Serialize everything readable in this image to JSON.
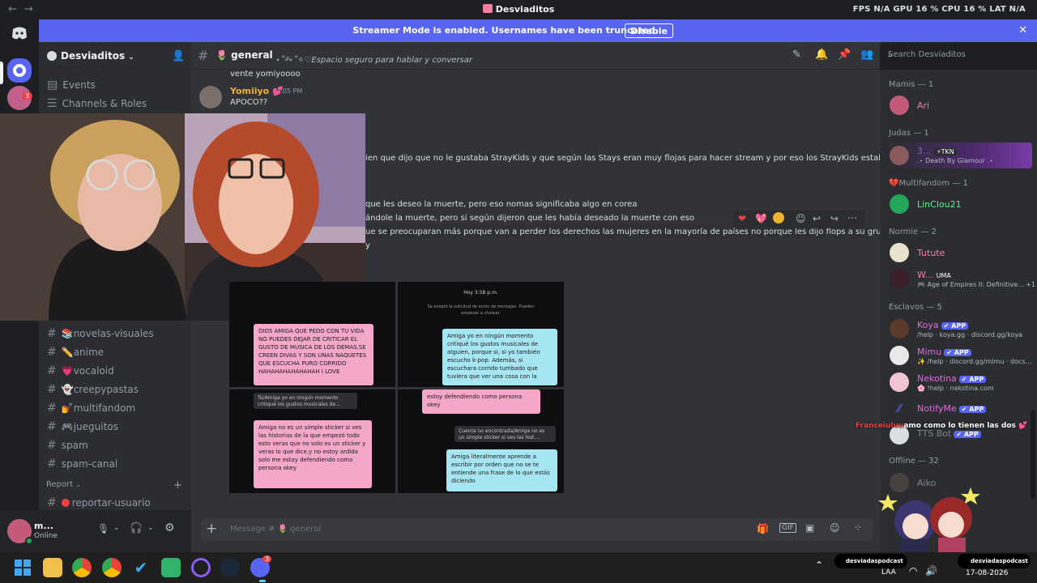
{
  "titlebar": {
    "back": "←",
    "forward": "→",
    "title": "Desviaditos",
    "stats": "FPS  N/A   GPU 16 %   CPU 16 %   LAT  N/A"
  },
  "banner": {
    "text": "Streamer Mode is enabled. Usernames have been truncated.",
    "button": "Disable",
    "close": "✕"
  },
  "server": {
    "name": "Desviaditos"
  },
  "sidebar": {
    "events": "Events",
    "channels_roles": "Channels & Roles",
    "channels": [
      "novelas-visuales",
      "anime",
      "vocaloid",
      "creepypastas",
      "multifandom",
      "jueguitos",
      "spam",
      "spam-canal"
    ],
    "channel_emojis": [
      "📚",
      "✏️",
      "💗",
      "👻",
      "💅",
      "🎮",
      "",
      ""
    ],
    "category_report": "Report",
    "report_channel": "reportar-usuario"
  },
  "chat": {
    "channel": "general",
    "topic": "⋆˚࿔⋆˚✧♡Espacio seguro para hablar y conversar",
    "search_placeholder": "Search Desviaditos",
    "input_placeholder": "Message # 🌷 general",
    "messages": [
      {
        "text": "vente yomiyoooo"
      },
      {
        "author": "Yomiiyo 💕",
        "time": "7:05 PM",
        "text": "APOCO??"
      },
      {
        "text": "ien que dijo que no le gustaba StrayKids y que según las Stays eran muy flojas para hacer stream y por eso los StrayKids estaban en flop,"
      },
      {
        "text": "que les deseo la muerte, pero eso nomas significaba algo en corea"
      },
      {
        "text": "ándole la muerte, pero si según dijeron que les había deseado la muerte con eso"
      },
      {
        "text": "ue se preocuparan más porque van a perder los derechos las mujeres en la mayoría de países no porque les dijo flops a su grupo"
      },
      {
        "text": "y"
      }
    ]
  },
  "screenshot_panels": {
    "p1_pink": "DIOS AMIGA QUE PEDO CON TU VIDA NO PUEDES DEJAR DE CRITICAR EL GUSTO DE MUSICA DE LOS DEMAS,SE CREEN DIVAS Y SON UNAS NAQUETES QUE ESCUCHA PURO CORRIDO HAHAHAHAHAHAHAH I LOVE",
    "p2_header_time": "Hoy 3:58 p.m.",
    "p2_header_note": "Se aceptó la solicitud de envío de mensajes. Pueden empezar a chatear.",
    "p2_blue": "Amiga yo en ningún momento critiqué los gustos musicales de alguien, porque si, si yo también escucho k-pop. Además, si escuchara corrido tumbado que tuviera que ver una cosa con la",
    "p3_grey": "Tú/Amiga yo en ningún momento critiqué los gustos musicales de...",
    "p3_pink": "Amiga no es un simple sticker si ves las historias de la que empezó todo esto veras que no solo es un sticker y veras lo que dice,y no estoy ardida solo me estoy defendiendo como persona okey",
    "p4_pink_top": "estoy defendiendo como persona okey",
    "p4_grey": "Cuenta no encontrada/Amiga no es un simple sticker si ves las hist...",
    "p4_blue": "Amiga literalmente aprende a escribir por orden que no se te entiende una frase de lo que estás diciendo"
  },
  "members": {
    "groups": [
      {
        "header": "Mamis — 1",
        "members": [
          {
            "name": "Ari",
            "color": "#f47fa0"
          }
        ]
      },
      {
        "header": "Judas — 1",
        "members": [
          {
            "name": "3...",
            "tag": "⚡TKN",
            "sub": ".⋆ Death By Glamour .⋆",
            "color": "#9b59d0"
          }
        ]
      },
      {
        "header": "💔Multifandom — 1",
        "members": [
          {
            "name": "LinClou21",
            "color": "#57f287"
          }
        ]
      },
      {
        "header": "Normie — 2",
        "members": [
          {
            "name": "Tutute",
            "color": "#f47fa0"
          },
          {
            "name": "W...",
            "tag": "UMA",
            "sub": "🎮 Age of Empires II: Definitive... +1",
            "color": "#f47fa0"
          }
        ]
      },
      {
        "header": "Esclavos — 5",
        "members": [
          {
            "name": "Koya",
            "app": "✔ APP",
            "sub": "/help · koya.gg · discord.gg/koya",
            "color": "#e06cdb"
          },
          {
            "name": "Mimu",
            "app": "✔ APP",
            "sub": "✨ /help · discord.gg/mimu · docs...",
            "color": "#e06cdb"
          },
          {
            "name": "Nekotina",
            "app": "✔ APP",
            "sub": "🌸 !help · nekotina.com",
            "color": "#e06cdb"
          },
          {
            "name": "NotifyMe",
            "app": "✔ APP",
            "color": "#e06cdb"
          },
          {
            "name": "TTS Bot",
            "app": "✔ APP",
            "color": "#e06cdb"
          }
        ]
      },
      {
        "header": "Offline — 32",
        "members": [
          {
            "name": "Aiko",
            "color": "#80848e"
          }
        ]
      }
    ]
  },
  "overlay_text": {
    "name": "Franceiuluu",
    "message": "amo como lo tienen las dos 💕"
  },
  "user": {
    "name": "m...",
    "status": "Online"
  },
  "taskbar": {
    "tiktok_label": "desviadaspodcast",
    "handle_label": "desviadaspodcast",
    "lang": "LAA",
    "date": "17-08-2026",
    "discord_badge": "3",
    "rail_badge": "3"
  },
  "colors": {
    "blurple": "#5865f2",
    "online": "#23a55a",
    "pink": "#f4a7c8",
    "blue": "#a6e6f3"
  }
}
